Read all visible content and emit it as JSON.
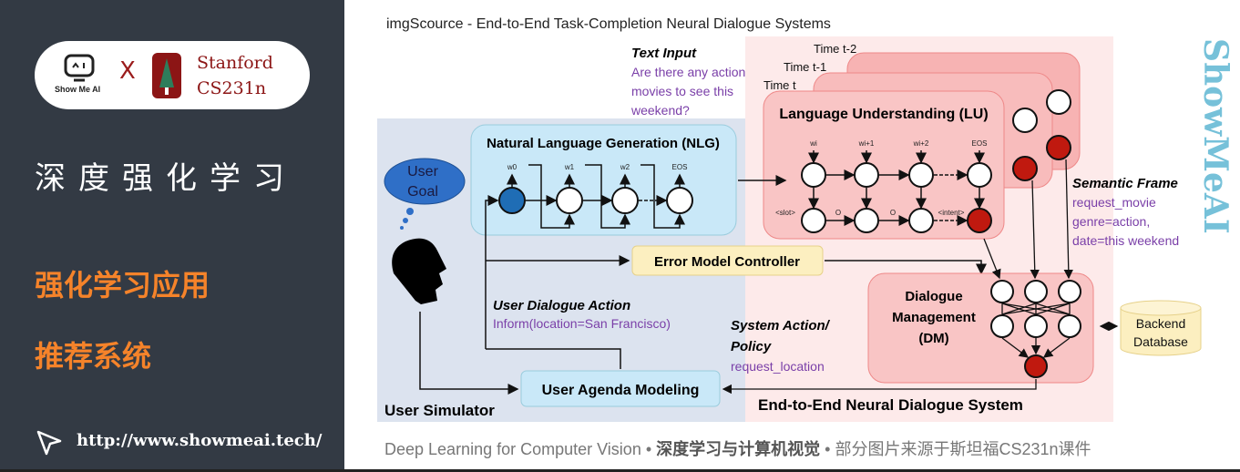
{
  "sidebar": {
    "logo": {
      "showmeai": "Show Me AI",
      "x": "X",
      "stanford_line1": "Stanford",
      "stanford_line2": "CS231n"
    },
    "title": "深度强化学习",
    "section1": "强化学习应用",
    "section2": "推荐系统",
    "url": "http://www.showmeai.tech/"
  },
  "source_caption": "imgScource -  End-to-End Task-Completion Neural Dialogue Systems",
  "diagram": {
    "text_input": {
      "heading": "Text Input",
      "lines": [
        "Are there any action",
        "movies to see this",
        "weekend?"
      ]
    },
    "time_labels": [
      "Time t-2",
      "Time t-1",
      "Time t"
    ],
    "nlg": {
      "title": "Natural Language Generation (NLG)",
      "tokens": [
        "w0",
        "w1",
        "w2",
        "EOS"
      ]
    },
    "lu": {
      "title": "Language Understanding (LU)",
      "tokens": [
        "wi",
        "wi+1",
        "wi+2",
        "EOS"
      ],
      "tags": [
        "<slot>",
        "O",
        "O",
        "<intent>"
      ]
    },
    "user_goal": [
      "User",
      "Goal"
    ],
    "semantic_frame": {
      "heading": "Semantic Frame",
      "lines": [
        "request_movie",
        "genre=action,",
        "date=this weekend"
      ]
    },
    "error_model": "Error Model Controller",
    "user_dialogue_action": {
      "heading": "User Dialogue Action",
      "value": "Inform(location=San Francisco)"
    },
    "system_action": {
      "heading_line1": "System Action/",
      "heading_line2": "Policy",
      "value": "request_location"
    },
    "dm": [
      "Dialogue",
      "Management",
      "(DM)"
    ],
    "backend": [
      "Backend",
      "Database"
    ],
    "user_agenda": "User Agenda Modeling",
    "user_simulator": "User Simulator",
    "e2e": "End-to-End Neural Dialogue System",
    "watermark": "ShowMeAI"
  },
  "footer": {
    "part1": "Deep Learning for Computer Vision",
    "sep": " • ",
    "part2": "深度学习与计算机视觉",
    "part3": "部分图片来源于斯坦福CS231n课件"
  },
  "colors": {
    "sidebar_bg": "#333a44",
    "accent_orange": "#f5832a",
    "stanford_red": "#8c1515",
    "node_red": "#c0190f",
    "purple_text": "#7a3fa8"
  }
}
